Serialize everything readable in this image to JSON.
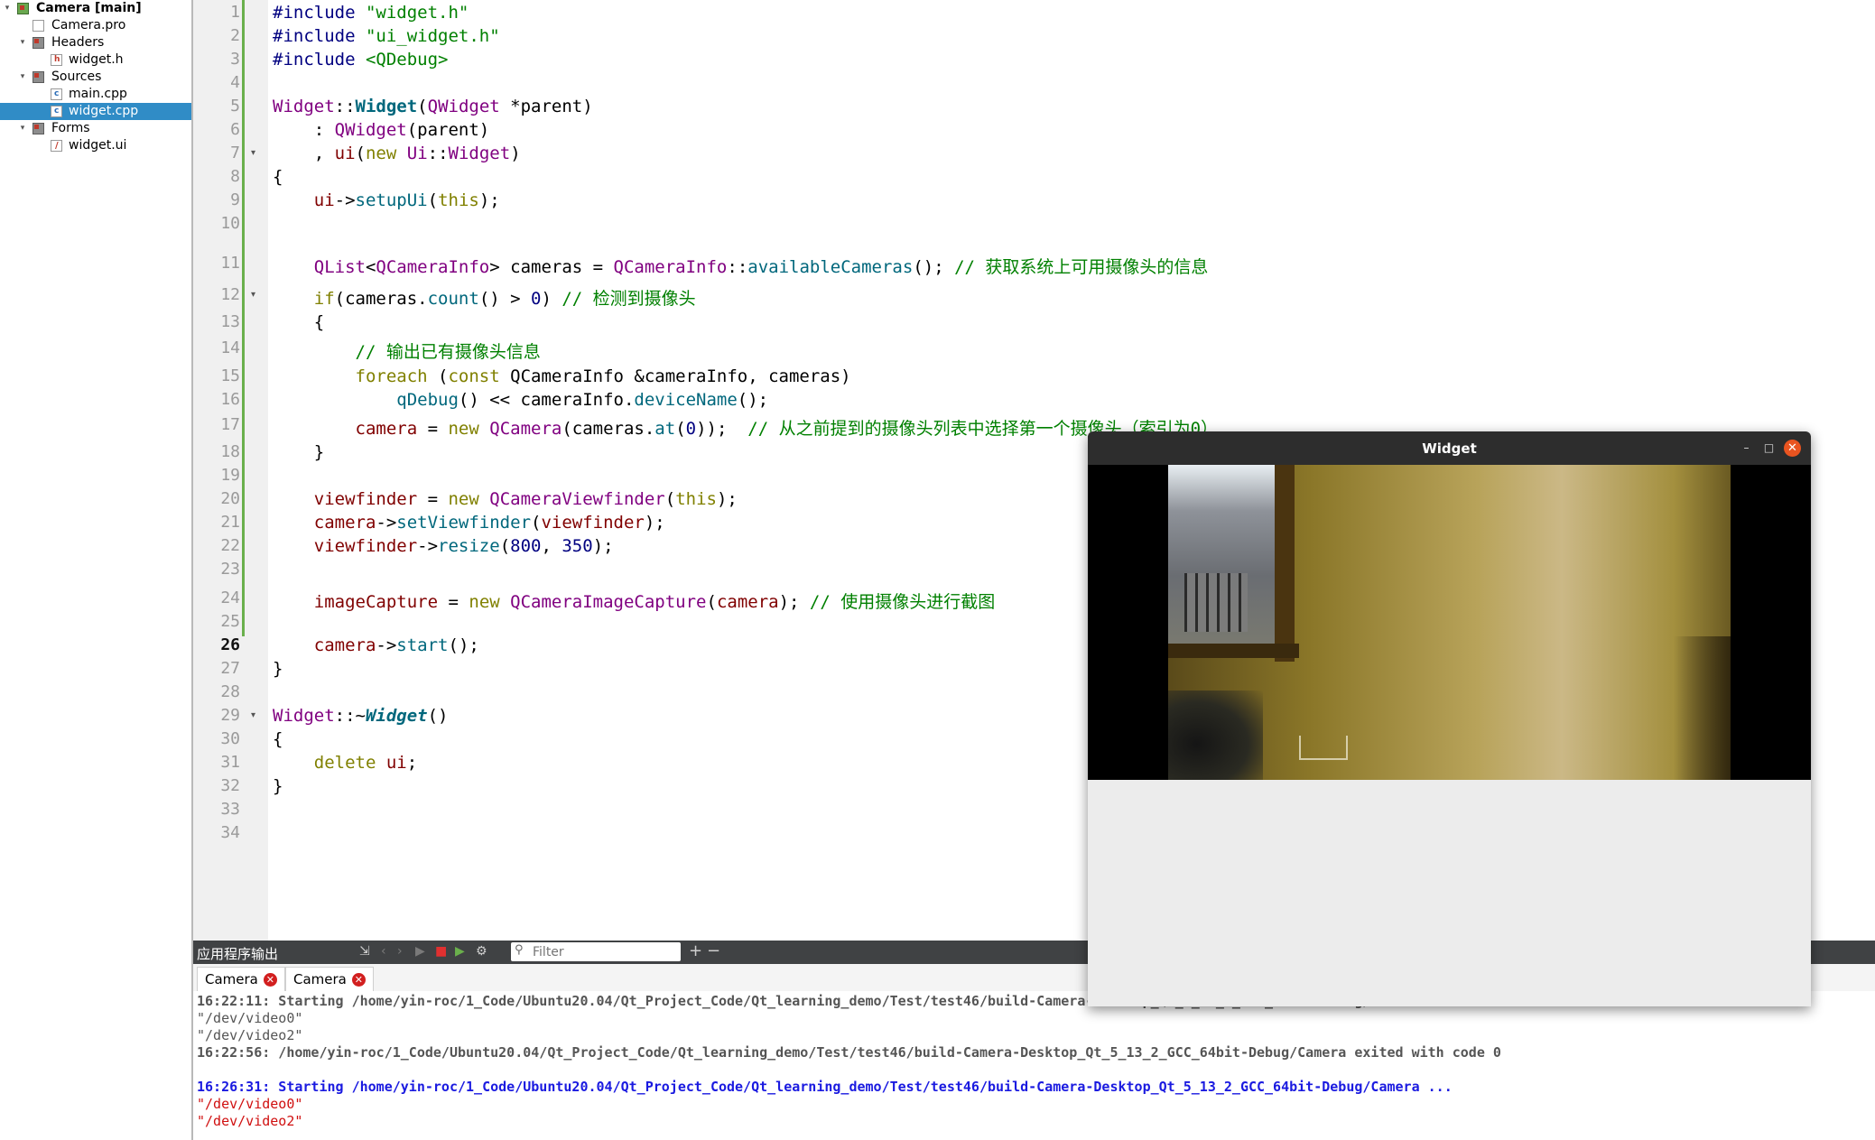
{
  "project_tree": {
    "items": [
      {
        "label": "Camera [main]",
        "type": "project",
        "level": 0,
        "expanded": true
      },
      {
        "label": "Camera.pro",
        "type": "pro-file",
        "level": 1
      },
      {
        "label": "Headers",
        "type": "folder",
        "level": 1,
        "expanded": true
      },
      {
        "label": "widget.h",
        "type": "header-file",
        "level": 2
      },
      {
        "label": "Sources",
        "type": "folder",
        "level": 1,
        "expanded": true
      },
      {
        "label": "main.cpp",
        "type": "source-file",
        "level": 2
      },
      {
        "label": "widget.cpp",
        "type": "source-file",
        "level": 2,
        "selected": true
      },
      {
        "label": "Forms",
        "type": "folder",
        "level": 1,
        "expanded": true
      },
      {
        "label": "widget.ui",
        "type": "ui-file",
        "level": 2
      }
    ]
  },
  "editor": {
    "current_line": 26,
    "lines": [
      {
        "n": "1",
        "parts": [
          [
            "pp",
            "#include "
          ],
          [
            "st",
            "\"widget.h\""
          ]
        ]
      },
      {
        "n": "2",
        "parts": [
          [
            "pp",
            "#include "
          ],
          [
            "st",
            "\"ui_widget.h\""
          ]
        ]
      },
      {
        "n": "3",
        "parts": [
          [
            "pp",
            "#include "
          ],
          [
            "st",
            "<QDebug>"
          ]
        ]
      },
      {
        "n": "4",
        "parts": []
      },
      {
        "n": "5",
        "parts": [
          [
            "ty",
            "Widget"
          ],
          [
            "",
            "::"
          ],
          [
            "fnb",
            "Widget"
          ],
          [
            "",
            "("
          ],
          [
            "ty",
            "QWidget"
          ],
          [
            "",
            " *"
          ],
          [
            "",
            "parent"
          ],
          [
            "",
            ")"
          ]
        ]
      },
      {
        "n": "6",
        "parts": [
          [
            "",
            "    : "
          ],
          [
            "ty",
            "QWidget"
          ],
          [
            "",
            "(parent)"
          ]
        ]
      },
      {
        "n": "7",
        "fold": true,
        "parts": [
          [
            "",
            "    , "
          ],
          [
            "mb",
            "ui"
          ],
          [
            "",
            "("
          ],
          [
            "kw",
            "new"
          ],
          [
            "",
            " "
          ],
          [
            "ty",
            "Ui"
          ],
          [
            "",
            "::"
          ],
          [
            "ty",
            "Widget"
          ],
          [
            "",
            ")"
          ]
        ]
      },
      {
        "n": "8",
        "parts": [
          [
            "",
            "{"
          ]
        ]
      },
      {
        "n": "9",
        "parts": [
          [
            "",
            "    "
          ],
          [
            "mb",
            "ui"
          ],
          [
            "",
            "->"
          ],
          [
            "fn",
            "setupUi"
          ],
          [
            "",
            "("
          ],
          [
            "kw",
            "this"
          ],
          [
            "",
            ");"
          ]
        ]
      },
      {
        "n": "10",
        "parts": []
      },
      {
        "n": "11",
        "parts": [
          [
            "",
            "    "
          ],
          [
            "ty",
            "QList"
          ],
          [
            "",
            "<"
          ],
          [
            "ty",
            "QCameraInfo"
          ],
          [
            "",
            "> cameras = "
          ],
          [
            "ty",
            "QCameraInfo"
          ],
          [
            "",
            "::"
          ],
          [
            "fn",
            "availableCameras"
          ],
          [
            "",
            "(); "
          ],
          [
            "cm",
            "// 获取系统上可用摄像头的信息"
          ]
        ]
      },
      {
        "n": "12",
        "fold": true,
        "parts": [
          [
            "",
            "    "
          ],
          [
            "kw",
            "if"
          ],
          [
            "",
            "(cameras."
          ],
          [
            "fn",
            "count"
          ],
          [
            "",
            "() > "
          ],
          [
            "nu",
            "0"
          ],
          [
            "",
            ") "
          ],
          [
            "cm",
            "// 检测到摄像头"
          ]
        ]
      },
      {
        "n": "13",
        "parts": [
          [
            "",
            "    {"
          ]
        ]
      },
      {
        "n": "14",
        "parts": [
          [
            "",
            "        "
          ],
          [
            "cm",
            "// 输出已有摄像头信息"
          ]
        ]
      },
      {
        "n": "15",
        "parts": [
          [
            "",
            "        "
          ],
          [
            "kw",
            "foreach"
          ],
          [
            "",
            " ("
          ],
          [
            "kw",
            "const"
          ],
          [
            "",
            " QCameraInfo &cameraInfo, cameras)"
          ]
        ]
      },
      {
        "n": "16",
        "parts": [
          [
            "",
            "            "
          ],
          [
            "fn",
            "qDebug"
          ],
          [
            "",
            "() << cameraInfo."
          ],
          [
            "fn",
            "deviceName"
          ],
          [
            "",
            "();"
          ]
        ]
      },
      {
        "n": "17",
        "parts": [
          [
            "",
            "        "
          ],
          [
            "mb",
            "camera"
          ],
          [
            "",
            " = "
          ],
          [
            "kw",
            "new"
          ],
          [
            "",
            " "
          ],
          [
            "ty",
            "QCamera"
          ],
          [
            "",
            "(cameras."
          ],
          [
            "fn",
            "at"
          ],
          [
            "",
            "("
          ],
          [
            "nu",
            "0"
          ],
          [
            "",
            "));  "
          ],
          [
            "cm",
            "// 从之前提到的摄像头列表中选择第一个摄像头（索引为0）"
          ]
        ]
      },
      {
        "n": "18",
        "parts": [
          [
            "",
            "    }"
          ]
        ]
      },
      {
        "n": "19",
        "parts": []
      },
      {
        "n": "20",
        "parts": [
          [
            "",
            "    "
          ],
          [
            "mb",
            "viewfinder"
          ],
          [
            "",
            " = "
          ],
          [
            "kw",
            "new"
          ],
          [
            "",
            " "
          ],
          [
            "ty",
            "QCameraViewfinder"
          ],
          [
            "",
            "("
          ],
          [
            "kw",
            "this"
          ],
          [
            "",
            ");"
          ]
        ]
      },
      {
        "n": "21",
        "parts": [
          [
            "",
            "    "
          ],
          [
            "mb",
            "camera"
          ],
          [
            "",
            "->"
          ],
          [
            "fn",
            "setViewfinder"
          ],
          [
            "",
            "("
          ],
          [
            "mb",
            "viewfinder"
          ],
          [
            "",
            ");"
          ]
        ]
      },
      {
        "n": "22",
        "parts": [
          [
            "",
            "    "
          ],
          [
            "mb",
            "viewfinder"
          ],
          [
            "",
            "->"
          ],
          [
            "fn",
            "resize"
          ],
          [
            "",
            "("
          ],
          [
            "nu",
            "800"
          ],
          [
            "",
            ", "
          ],
          [
            "nu",
            "350"
          ],
          [
            "",
            ");"
          ]
        ]
      },
      {
        "n": "23",
        "parts": []
      },
      {
        "n": "24",
        "parts": [
          [
            "",
            "    "
          ],
          [
            "mb",
            "imageCapture"
          ],
          [
            "",
            " = "
          ],
          [
            "kw",
            "new"
          ],
          [
            "",
            " "
          ],
          [
            "ty",
            "QCameraImageCapture"
          ],
          [
            "",
            "("
          ],
          [
            "mb",
            "camera"
          ],
          [
            "",
            "); "
          ],
          [
            "cm",
            "// 使用摄像头进行截图"
          ]
        ]
      },
      {
        "n": "25",
        "parts": []
      },
      {
        "n": "26",
        "parts": [
          [
            "",
            "    "
          ],
          [
            "mb",
            "camera"
          ],
          [
            "",
            "->"
          ],
          [
            "fn",
            "start"
          ],
          [
            "",
            "();"
          ]
        ]
      },
      {
        "n": "27",
        "parts": [
          [
            "",
            "}"
          ]
        ]
      },
      {
        "n": "28",
        "parts": []
      },
      {
        "n": "29",
        "fold": true,
        "parts": [
          [
            "ty",
            "Widget"
          ],
          [
            "",
            "::~"
          ],
          [
            "fni",
            "Widget"
          ],
          [
            "",
            "()"
          ]
        ]
      },
      {
        "n": "30",
        "parts": [
          [
            "",
            "{"
          ]
        ]
      },
      {
        "n": "31",
        "parts": [
          [
            "",
            "    "
          ],
          [
            "kw",
            "delete"
          ],
          [
            "",
            " "
          ],
          [
            "mb",
            "ui"
          ],
          [
            "",
            ";"
          ]
        ]
      },
      {
        "n": "32",
        "parts": [
          [
            "",
            "}"
          ]
        ]
      },
      {
        "n": "33",
        "parts": []
      },
      {
        "n": "34",
        "parts": []
      }
    ]
  },
  "output_pane": {
    "title": "应用程序输出",
    "filter_placeholder": "Filter",
    "plus_label": "+",
    "minus_label": "−",
    "tabs": [
      {
        "label": "Camera"
      },
      {
        "label": "Camera"
      }
    ],
    "lines": [
      {
        "style": "gb",
        "text": "16:22:11: Starting /home/yin-roc/1_Code/Ubuntu20.04/Qt_Project_Code/Qt_learning_demo/Test/test46/build-Camera-Desktop_Qt_5_13_2_GCC_64bit-Debug/Camera ..."
      },
      {
        "style": "g",
        "text": "\"/dev/video0\""
      },
      {
        "style": "g",
        "text": "\"/dev/video2\""
      },
      {
        "style": "gb",
        "text": "16:22:56: /home/yin-roc/1_Code/Ubuntu20.04/Qt_Project_Code/Qt_learning_demo/Test/test46/build-Camera-Desktop_Qt_5_13_2_GCC_64bit-Debug/Camera exited with code 0"
      },
      {
        "style": "g",
        "text": ""
      },
      {
        "style": "b",
        "text": "16:26:31: Starting /home/yin-roc/1_Code/Ubuntu20.04/Qt_Project_Code/Qt_learning_demo/Test/test46/build-Camera-Desktop_Qt_5_13_2_GCC_64bit-Debug/Camera ..."
      },
      {
        "style": "r",
        "text": "\"/dev/video0\""
      },
      {
        "style": "r",
        "text": "\"/dev/video2\""
      }
    ]
  },
  "widget_window": {
    "title": "Widget",
    "minimize_glyph": "–",
    "maximize_glyph": "□",
    "close_glyph": "✕"
  }
}
